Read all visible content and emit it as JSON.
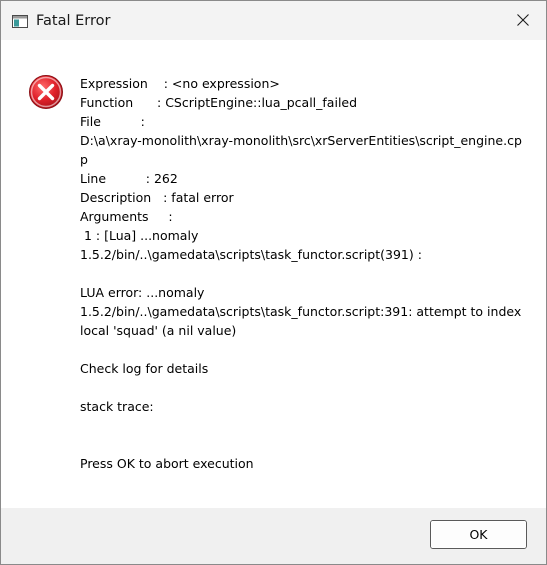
{
  "window": {
    "title": "Fatal Error",
    "icons": {
      "app": "app-window-icon",
      "close": "close-icon",
      "error": "error-icon"
    },
    "colors": {
      "error_red": "#e0212a"
    }
  },
  "message": {
    "lines": [
      "Expression    : <no expression>",
      "Function      : CScriptEngine::lua_pcall_failed",
      "File          :",
      "D:\\a\\xray-monolith\\xray-monolith\\src\\xrServerEntities\\script_engine.cp",
      "p",
      "Line          : 262",
      "Description   : fatal error",
      "Arguments     :",
      " 1 : [Lua] ...nomaly",
      "1.5.2/bin/..\\gamedata\\scripts\\task_functor.script(391) :",
      "",
      "LUA error: ...nomaly",
      "1.5.2/bin/..\\gamedata\\scripts\\task_functor.script:391: attempt to index",
      "local 'squad' (a nil value)",
      "",
      "Check log for details",
      "",
      "stack trace:",
      "",
      "",
      "Press OK to abort execution"
    ]
  },
  "footer": {
    "ok_label": "OK"
  }
}
